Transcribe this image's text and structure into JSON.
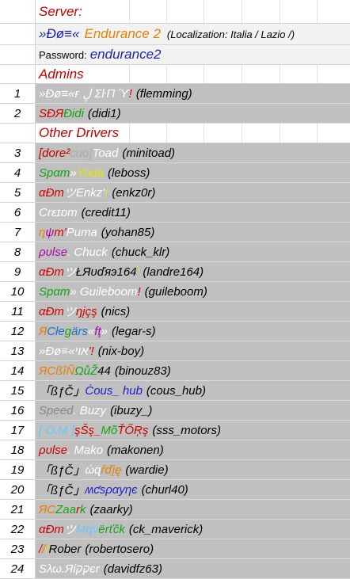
{
  "server": {
    "label": "Server:",
    "name_prefix": "»Ðø≡«",
    "name_main": "Endurance 2",
    "localization": "(Localization: Italia / Lazio /)",
    "password_label": "Password:",
    "password_value": "endurance2"
  },
  "admins": {
    "label": "Admins",
    "rows": [
      {
        "num": "1",
        "parts": [
          {
            "t": "»Ðø≡«",
            "c": "#ffffff"
          },
          {
            "t": " ғ ڸ Σ",
            "c": "#ffffff"
          },
          {
            "t": "ŀП ϓ",
            "c": "#ffffff"
          },
          {
            "t": " !",
            "c": "#d00000"
          }
        ],
        "handle": "(flemming)"
      },
      {
        "num": "2",
        "parts": [
          {
            "t": "SÐЯ",
            "c": "#d00000"
          },
          {
            "t": " Ðidi",
            "c": "#17a317"
          }
        ],
        "handle": "(didi1)"
      }
    ]
  },
  "other": {
    "label": "Other Drivers",
    "rows": [
      {
        "num": "3",
        "parts": [
          {
            "t": "[dore²",
            "c": "#c00000"
          },
          {
            "t": "cuo]",
            "c": "#aaaaaa"
          },
          {
            "t": " Toad",
            "c": "#ffffff"
          }
        ],
        "handle": "(minitoad)"
      },
      {
        "num": "4",
        "parts": [
          {
            "t": "S",
            "c": "#17a317"
          },
          {
            "t": "p",
            "c": "#17a317"
          },
          {
            "t": "α",
            "c": "#17a317"
          },
          {
            "t": "m",
            "c": "#17a317"
          },
          {
            "t": " »",
            "c": "#ffffff"
          },
          {
            "t": " Yoda",
            "c": "#e5e500"
          }
        ],
        "handle": "(leboss)"
      },
      {
        "num": "5",
        "parts": [
          {
            "t": "α",
            "c": "#d00000"
          },
          {
            "t": " Ð",
            "c": "#d00000"
          },
          {
            "t": " m",
            "c": "#d00000"
          },
          {
            "t": " ツ",
            "c": "#ffffff"
          },
          {
            "t": "Enkz'",
            "c": "#ffffff"
          },
          {
            "t": " !",
            "c": "#ffdd00"
          }
        ],
        "handle": "(enkz0r)"
      },
      {
        "num": "6",
        "parts": [
          {
            "t": "Cɾɛɪɒm",
            "c": "#ffffff"
          }
        ],
        "handle": "(credit11)"
      },
      {
        "num": "7",
        "parts": [
          {
            "t": "η",
            "c": "#e87d00"
          },
          {
            "t": "ψ",
            "c": "#b000b0"
          },
          {
            "t": "m'",
            "c": "#d00000"
          },
          {
            "t": " Puma",
            "c": "#ffffff"
          }
        ],
        "handle": "(yohan85)"
      },
      {
        "num": "8",
        "parts": [
          {
            "t": "ρ",
            "c": "#b000b0"
          },
          {
            "t": "υ",
            "c": "#b000b0"
          },
          {
            "t": "l",
            "c": "#b000b0"
          },
          {
            "t": "s",
            "c": "#b000b0"
          },
          {
            "t": "e",
            "c": "#b000b0"
          },
          {
            "t": ". Chuck",
            "c": "#ffffff"
          }
        ],
        "handle": "(chuck_klr)"
      },
      {
        "num": "9",
        "parts": [
          {
            "t": " α",
            "c": "#d00000"
          },
          {
            "t": " Ð",
            "c": "#d00000"
          },
          {
            "t": " m",
            "c": "#d00000"
          },
          {
            "t": " ツ",
            "c": "#ffffff"
          },
          {
            "t": " ŁЯυďяэ164",
            "c": "#000000"
          },
          {
            "t": " '",
            "c": "#ffdd00"
          }
        ],
        "handle": "(landre164)"
      },
      {
        "num": "10",
        "parts": [
          {
            "t": "S",
            "c": "#17a317"
          },
          {
            "t": "p",
            "c": "#17a317"
          },
          {
            "t": "α",
            "c": "#17a317"
          },
          {
            "t": "m",
            "c": "#17a317"
          },
          {
            "t": " » Guileboom",
            "c": "#ffffff"
          },
          {
            "t": " !",
            "c": "#d00000"
          }
        ],
        "handle": "(guileboom)"
      },
      {
        "num": "11",
        "parts": [
          {
            "t": "α",
            "c": "#d00000"
          },
          {
            "t": " Ð",
            "c": "#d00000"
          },
          {
            "t": " m",
            "c": "#d00000"
          },
          {
            "t": " ツ",
            "c": "#ffffff"
          },
          {
            "t": " ŋ",
            "c": "#d00000"
          },
          {
            "t": " į",
            "c": "#d00000"
          },
          {
            "t": " ç",
            "c": "#d00000"
          },
          {
            "t": " ş",
            "c": "#d00000"
          }
        ],
        "handle": "(nics)"
      },
      {
        "num": "12",
        "parts": [
          {
            "t": "Я",
            "c": "#e87d00"
          },
          {
            "t": " C",
            "c": "#1f6fd0"
          },
          {
            "t": " łe",
            "c": "#1f6fd0"
          },
          {
            "t": " g",
            "c": "#17a317"
          },
          {
            "t": " ä",
            "c": "#1f6fd0"
          },
          {
            "t": "r",
            "c": "#1f6fd0"
          },
          {
            "t": "s",
            "c": "#1f6fd0"
          },
          {
            "t": " «",
            "c": "#ffffff"
          },
          {
            "t": " f",
            "c": "#b000b0"
          },
          {
            "t": " ţ",
            "c": "#b000b0"
          },
          {
            "t": " »",
            "c": "#ffffff"
          }
        ],
        "handle": "(legar-s)"
      },
      {
        "num": "13",
        "parts": [
          {
            "t": "»Ðø≡«",
            "c": "#ffffff"
          },
          {
            "t": " אוי",
            "c": "#ffffff"
          },
          {
            "t": "'",
            "c": "#d00000"
          },
          {
            "t": " !",
            "c": "#d00000"
          }
        ],
        "handle": "(nix-boy)"
      },
      {
        "num": "14",
        "parts": [
          {
            "t": "Я",
            "c": "#e87d00"
          },
          {
            "t": " C",
            "c": "#e87d00"
          },
          {
            "t": "ßîÑ",
            "c": "#e87d00"
          },
          {
            "t": " ΩůŽ",
            "c": "#17a317"
          },
          {
            "t": " 44",
            "c": "#000000"
          }
        ],
        "handle": "(binouz83)"
      },
      {
        "num": "15",
        "parts": [
          {
            "t": " 「ßƒČ」",
            "c": "#000000"
          },
          {
            "t": " Ċ",
            "c": "#1f1fd0"
          },
          {
            "t": "ous_ hub",
            "c": "#1f1fd0"
          }
        ],
        "handle": "(cous_hub)"
      },
      {
        "num": "16",
        "parts": [
          {
            "t": "Speed",
            "c": "#888888"
          },
          {
            "t": ". Buzy",
            "c": "#ffffff"
          }
        ],
        "handle": "(ibuzy_)"
      },
      {
        "num": "17",
        "parts": [
          {
            "t": "[ O.M ]",
            "c": "#66c8ff"
          },
          {
            "t": " şŠş_",
            "c": "#d00000"
          },
          {
            "t": " Mõ",
            "c": "#17a317"
          },
          {
            "t": " ŤŐŖş",
            "c": "#d00000"
          }
        ],
        "handle": "(sss_motors)"
      },
      {
        "num": "18",
        "parts": [
          {
            "t": "ρυlse",
            "c": "#d00000"
          },
          {
            "t": ". Mako",
            "c": "#ffffff"
          }
        ],
        "handle": "(makonen)"
      },
      {
        "num": "19",
        "parts": [
          {
            "t": " 「ßƒČ」",
            "c": "#000000"
          },
          {
            "t": " ώ",
            "c": "#ffffff"
          },
          {
            "t": "ɋ",
            "c": "#ffffff"
          },
          {
            "t": "ŕďįę",
            "c": "#e87d00"
          }
        ],
        "handle": "(wardie)"
      },
      {
        "num": "20",
        "parts": [
          {
            "t": " 「ßƒČ」",
            "c": "#000000"
          },
          {
            "t": "   ʍ",
            "c": "#1f1fd0"
          },
          {
            "t": "ƈ",
            "c": "#1f1fd0"
          },
          {
            "t": " ѕραуηє",
            "c": "#1f1fd0"
          }
        ],
        "handle": "(churl40)"
      },
      {
        "num": "21",
        "parts": [
          {
            "t": "Я",
            "c": "#e87d00"
          },
          {
            "t": " C",
            "c": "#e87d00"
          },
          {
            "t": " Z",
            "c": "#17a317"
          },
          {
            "t": " a",
            "c": "#17a317"
          },
          {
            "t": " a",
            "c": "#17a317"
          },
          {
            "t": " r",
            "c": "#d00000"
          },
          {
            "t": " k",
            "c": "#17a317"
          }
        ],
        "handle": "(zaarky)"
      },
      {
        "num": "22",
        "parts": [
          {
            "t": "α",
            "c": "#d00000"
          },
          {
            "t": " Ð",
            "c": "#d00000"
          },
          {
            "t": " m",
            "c": "#d00000"
          },
          {
            "t": " ツ",
            "c": "#ffffff"
          },
          {
            "t": " M",
            "c": "#66c8ff"
          },
          {
            "t": "q",
            "c": "#66c8ff"
          },
          {
            "t": "ν",
            "c": "#66c8ff"
          },
          {
            "t": "ë",
            "c": "#17a317"
          },
          {
            "t": "r",
            "c": "#17a317"
          },
          {
            "t": "ť",
            "c": "#17a317"
          },
          {
            "t": "č",
            "c": "#17a317"
          },
          {
            "t": "k",
            "c": "#17a317"
          }
        ],
        "handle": "(ck_maverick)"
      },
      {
        "num": "23",
        "parts": [
          {
            "t": " /",
            "c": "#d00000"
          },
          {
            "t": " /",
            "c": "#e87d00"
          },
          {
            "t": " /",
            "c": "#e5e500"
          },
          {
            "t": " Rober",
            "c": "#000000"
          }
        ],
        "handle": "(robertosero)"
      },
      {
        "num": "24",
        "parts": [
          {
            "t": "Sλω.",
            "c": "#ffffff"
          },
          {
            "t": "Яίקקєr",
            "c": "#ffffff"
          }
        ],
        "handle": "(davidfz63)"
      }
    ]
  }
}
